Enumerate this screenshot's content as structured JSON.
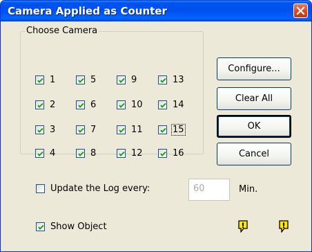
{
  "window": {
    "title": "Camera Applied as Counter"
  },
  "camera_group": {
    "legend": "Choose Camera",
    "cameras": [
      {
        "label": "1",
        "checked": true
      },
      {
        "label": "5",
        "checked": true
      },
      {
        "label": "9",
        "checked": true
      },
      {
        "label": "13",
        "checked": true
      },
      {
        "label": "2",
        "checked": true
      },
      {
        "label": "6",
        "checked": true
      },
      {
        "label": "10",
        "checked": true
      },
      {
        "label": "14",
        "checked": true
      },
      {
        "label": "3",
        "checked": true
      },
      {
        "label": "7",
        "checked": true
      },
      {
        "label": "11",
        "checked": true
      },
      {
        "label": "15",
        "checked": true,
        "focused": true
      },
      {
        "label": "4",
        "checked": true
      },
      {
        "label": "8",
        "checked": true
      },
      {
        "label": "12",
        "checked": true
      },
      {
        "label": "16",
        "checked": true
      }
    ]
  },
  "buttons": {
    "configure": "Configure...",
    "clear_all": "Clear All",
    "ok": "OK",
    "cancel": "Cancel"
  },
  "log": {
    "label": "Update the Log every:",
    "checked": false,
    "interval_value": "60",
    "unit": "Min."
  },
  "show_object": {
    "label": "Show Object",
    "checked": true
  },
  "icons": {
    "close": "close-icon",
    "checkmark": "checkmark-icon",
    "warning": "warning-icon"
  },
  "colors": {
    "title_bar": "#0055e5",
    "close_button": "#d64a22",
    "dialog_bg": "#ece9d8",
    "checkmark": "#21a121",
    "warning_icon": "#ffe600"
  }
}
